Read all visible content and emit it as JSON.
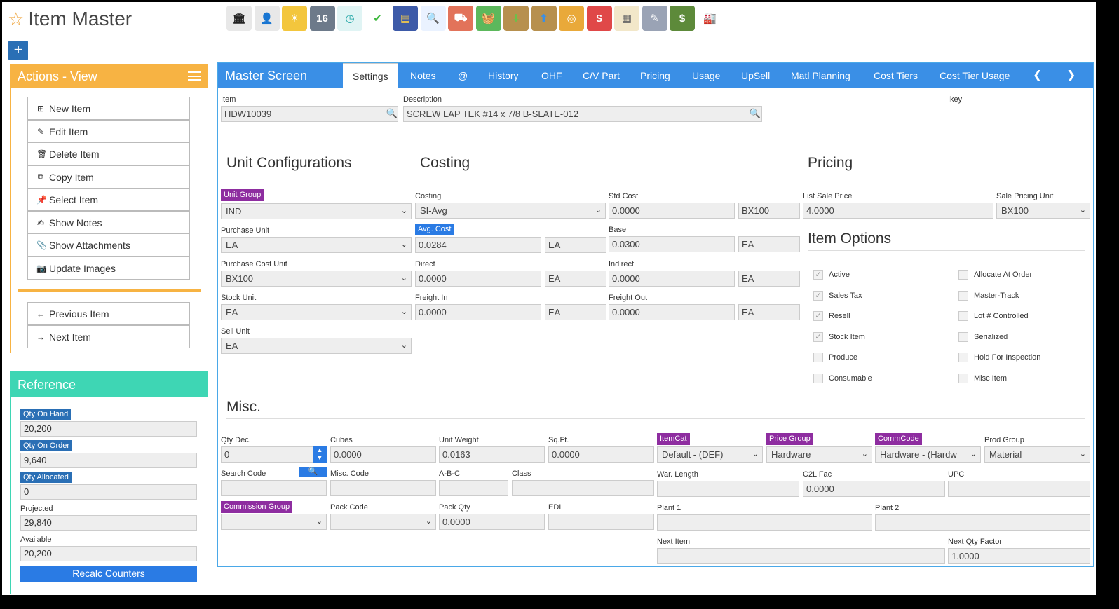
{
  "page": {
    "title": "Item Master",
    "colors": {
      "accent": "#3a8fe6",
      "actions": "#f7b343",
      "reference": "#3ed6b4",
      "badge_purple": "#8e2da0",
      "badge_blue": "#2a7be4"
    }
  },
  "toolbar": {
    "icons": [
      "bank-icon",
      "user-icon",
      "weather-icon",
      "calendar-icon",
      "clock-icon",
      "check-icon",
      "keyboard-icon",
      "search-icon",
      "truck-icon",
      "basket-icon",
      "inbox-download-icon",
      "outbox-upload-icon",
      "coins-icon",
      "price-bubble-icon",
      "notepad-icon",
      "pencil-icon",
      "money-icon",
      "factory-icon"
    ],
    "calendar_day": "16"
  },
  "actions": {
    "title": "Actions - View",
    "items": [
      "New Item",
      "Edit Item",
      "Delete Item",
      "Copy Item",
      "Select Item",
      "Show Notes",
      "Show Attachments",
      "Update Images"
    ],
    "nav": [
      "Previous Item",
      "Next Item"
    ]
  },
  "reference": {
    "title": "Reference",
    "qty_on_hand_label": "Qty On Hand",
    "qty_on_hand": "20,200",
    "qty_on_order_label": "Qty On Order",
    "qty_on_order": "9,640",
    "qty_allocated_label": "Qty Allocated",
    "qty_allocated": "0",
    "projected_label": "Projected",
    "projected": "29,840",
    "available_label": "Available",
    "available": "20,200",
    "recalc_label": "Recalc Counters"
  },
  "master": {
    "title": "Master Screen",
    "tabs": [
      "Settings",
      "Notes",
      "@",
      "History",
      "OHF",
      "C/V Part",
      "Pricing",
      "Usage",
      "UpSell",
      "Matl Planning",
      "Cost Tiers",
      "Cost Tier Usage"
    ],
    "active_tab": "Settings",
    "item_label": "Item",
    "item": "HDW10039",
    "description_label": "Description",
    "description": "SCREW LAP TEK #14 x 7/8 B-SLATE-012",
    "ikey_label": "Ikey"
  },
  "unit_config": {
    "title": "Unit Configurations",
    "unit_group_label": "Unit Group",
    "unit_group": "IND",
    "purchase_unit_label": "Purchase Unit",
    "purchase_unit": "EA",
    "purchase_cost_unit_label": "Purchase Cost Unit",
    "purchase_cost_unit": "BX100",
    "stock_unit_label": "Stock Unit",
    "stock_unit": "EA",
    "sell_unit_label": "Sell Unit",
    "sell_unit": "EA"
  },
  "costing": {
    "title": "Costing",
    "costing_label": "Costing",
    "costing": "SI-Avg",
    "avg_cost_label": "Avg. Cost",
    "avg_cost": "0.0284",
    "avg_cost_unit": "EA",
    "direct_label": "Direct",
    "direct": "0.0000",
    "direct_unit": "EA",
    "freight_in_label": "Freight In",
    "freight_in": "0.0000",
    "freight_in_unit": "EA",
    "std_cost_label": "Std Cost",
    "std_cost": "0.0000",
    "std_cost_unit": "BX100",
    "base_label": "Base",
    "base": "0.0300",
    "base_unit": "EA",
    "indirect_label": "Indirect",
    "indirect": "0.0000",
    "indirect_unit": "EA",
    "freight_out_label": "Freight Out",
    "freight_out": "0.0000",
    "freight_out_unit": "EA"
  },
  "pricing": {
    "title": "Pricing",
    "list_sale_price_label": "List Sale Price",
    "list_sale_price": "4.0000",
    "sale_pricing_unit_label": "Sale Pricing Unit",
    "sale_pricing_unit": "BX100"
  },
  "item_options": {
    "title": "Item Options",
    "left": [
      {
        "label": "Active",
        "checked": true
      },
      {
        "label": "Sales Tax",
        "checked": true
      },
      {
        "label": "Resell",
        "checked": true
      },
      {
        "label": "Stock Item",
        "checked": true
      },
      {
        "label": "Produce",
        "checked": false
      },
      {
        "label": "Consumable",
        "checked": false
      }
    ],
    "right": [
      {
        "label": "Allocate At Order",
        "checked": false
      },
      {
        "label": "Master-Track",
        "checked": false
      },
      {
        "label": "Lot # Controlled",
        "checked": false
      },
      {
        "label": "Serialized",
        "checked": false
      },
      {
        "label": "Hold For Inspection",
        "checked": false
      },
      {
        "label": "Misc Item",
        "checked": false
      }
    ]
  },
  "misc": {
    "title": "Misc.",
    "qty_dec_label": "Qty Dec.",
    "qty_dec": "0",
    "cubes_label": "Cubes",
    "cubes": "0.0000",
    "unit_weight_label": "Unit Weight",
    "unit_weight": "0.0163",
    "sqft_label": "Sq.Ft.",
    "sqft": "0.0000",
    "itemcat_label": "ItemCat",
    "itemcat": "Default - (DEF)",
    "price_group_label": "Price Group",
    "price_group": "Hardware",
    "commcode_label": "CommCode",
    "commcode": "Hardware - (Hardw",
    "prod_group_label": "Prod Group",
    "prod_group": "Material",
    "search_code_label": "Search Code",
    "search_code": "",
    "misc_code_label": "Misc. Code",
    "misc_code": "",
    "abc_label": "A-B-C",
    "abc": "",
    "class_label": "Class",
    "class": "",
    "war_length_label": "War. Length",
    "war_length": "",
    "c2l_fac_label": "C2L Fac",
    "c2l_fac": "0.0000",
    "upc_label": "UPC",
    "upc": "",
    "commission_group_label": "Commission Group",
    "commission_group": "",
    "pack_code_label": "Pack Code",
    "pack_code": "",
    "pack_qty_label": "Pack Qty",
    "pack_qty": "0.0000",
    "edi_label": "EDI",
    "edi": "",
    "plant1_label": "Plant 1",
    "plant1": "",
    "plant2_label": "Plant 2",
    "plant2": "",
    "next_item_label": "Next Item",
    "next_item": "",
    "next_qty_factor_label": "Next Qty Factor",
    "next_qty_factor": "1.0000"
  }
}
